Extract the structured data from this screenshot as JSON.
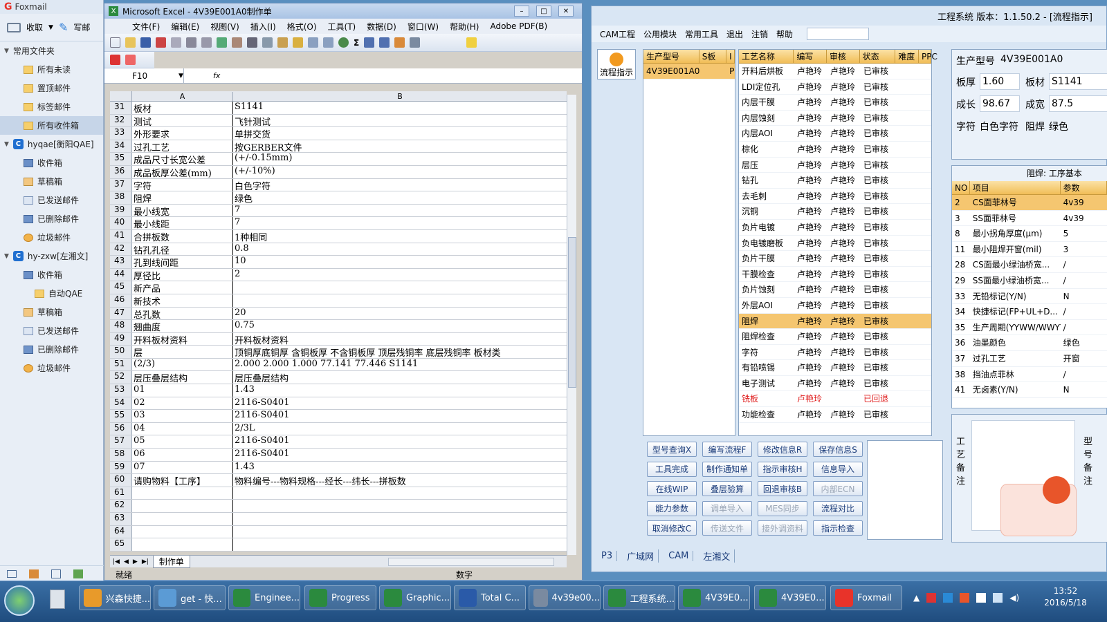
{
  "foxmail": {
    "title": "Foxmail",
    "toolbar": {
      "receive": "收取",
      "write": "写邮"
    },
    "sections": [
      {
        "label": "常用文件夹",
        "items": [
          "所有未读",
          "置顶邮件",
          "标签邮件",
          "所有收件箱"
        ]
      },
      {
        "label": "hyqae[衡阳QAE]",
        "items": [
          "收件箱",
          "草稿箱",
          "已发送邮件",
          "已删除邮件",
          "垃圾邮件"
        ]
      },
      {
        "label": "hy-zxw[左湘文]",
        "items": [
          "收件箱",
          "自动QAE",
          "草稿箱",
          "已发送邮件",
          "已删除邮件",
          "垃圾邮件"
        ]
      }
    ]
  },
  "excel": {
    "title": "Microsoft Excel - 4V39E001A0制作单",
    "menu": [
      "文件(F)",
      "编辑(E)",
      "视图(V)",
      "插入(I)",
      "格式(O)",
      "工具(T)",
      "数据(D)",
      "窗口(W)",
      "帮助(H)",
      "Adobe PDF(B)"
    ],
    "name_box": "F10",
    "fx": "fx",
    "col_a": "A",
    "col_b": "B",
    "rows": [
      [
        "31",
        "板材",
        "S1141"
      ],
      [
        "32",
        "测试",
        "飞针测试"
      ],
      [
        "33",
        "外形要求",
        "单拼交货"
      ],
      [
        "34",
        "过孔工艺",
        "按GERBER文件"
      ],
      [
        "35",
        "成品尺寸长宽公差",
        "(+/-0.15mm)"
      ],
      [
        "36",
        "成品板厚公差(mm)",
        "(+/-10%)"
      ],
      [
        "37",
        "字符",
        "白色字符"
      ],
      [
        "38",
        "阻焊",
        "绿色"
      ],
      [
        "39",
        "最小线宽",
        "7"
      ],
      [
        "40",
        "最小线距",
        "7"
      ],
      [
        "41",
        "合拼板数",
        "1种相同"
      ],
      [
        "42",
        "钻孔孔径",
        "0.8"
      ],
      [
        "43",
        "孔到线间距",
        "10"
      ],
      [
        "44",
        "厚径比",
        "2"
      ],
      [
        "45",
        "新产品",
        ""
      ],
      [
        "46",
        "新技术",
        ""
      ],
      [
        "47",
        "总孔数",
        "20"
      ],
      [
        "48",
        "翘曲度",
        "0.75"
      ],
      [
        "49",
        "开料板材资料",
        "开料板材资料"
      ],
      [
        "50",
        "层",
        "顶铜厚底铜厚 含铜板厚 不含铜板厚 顶层残铜率 底层残铜率 板材类"
      ],
      [
        "51",
        "(2/3)",
        "2.000  2.000   1.000            77.141    77.446       S1141"
      ],
      [
        "52",
        "层压叠层结构",
        "层压叠层结构"
      ],
      [
        "53",
        "01",
        "1.43"
      ],
      [
        "54",
        "02",
        "2116-S0401"
      ],
      [
        "55",
        "03",
        "2116-S0401"
      ],
      [
        "56",
        "04",
        "2/3L"
      ],
      [
        "57",
        "05",
        "2116-S0401"
      ],
      [
        "58",
        "06",
        "2116-S0401"
      ],
      [
        "59",
        "07",
        "1.43"
      ],
      [
        "60",
        "请购物料【工序】",
        "物料编号---物料规格---经长---纬长---拼板数"
      ],
      [
        "61",
        "",
        ""
      ],
      [
        "62",
        "",
        ""
      ],
      [
        "63",
        "",
        ""
      ],
      [
        "64",
        "",
        ""
      ],
      [
        "65",
        "",
        ""
      ]
    ],
    "sheet_tab": "制作单",
    "status_left": "就绪",
    "status_num": "数字"
  },
  "eng": {
    "title": "工程系统  版本：1.1.50.2 - [流程指示]",
    "menu": [
      "CAM工程",
      "公用模块",
      "常用工具",
      "退出",
      "注销",
      "帮助"
    ],
    "side_btn": "流程指示",
    "model_table": {
      "headers": [
        "生产型号",
        "S板",
        "I"
      ],
      "rows": [
        [
          "4V39E001A0",
          "",
          "P"
        ]
      ]
    },
    "process_headers": [
      "工艺名称",
      "编写",
      "审核",
      "状态",
      "难度",
      "PPC"
    ],
    "process_rows": [
      [
        "开料后烘板",
        "卢艳玲",
        "卢艳玲",
        "已审核"
      ],
      [
        "LDI定位孔",
        "卢艳玲",
        "卢艳玲",
        "已审核"
      ],
      [
        "内层干膜",
        "卢艳玲",
        "卢艳玲",
        "已审核"
      ],
      [
        "内层蚀刻",
        "卢艳玲",
        "卢艳玲",
        "已审核"
      ],
      [
        "内层AOI",
        "卢艳玲",
        "卢艳玲",
        "已审核"
      ],
      [
        "棕化",
        "卢艳玲",
        "卢艳玲",
        "已审核"
      ],
      [
        "层压",
        "卢艳玲",
        "卢艳玲",
        "已审核"
      ],
      [
        "钻孔",
        "卢艳玲",
        "卢艳玲",
        "已审核"
      ],
      [
        "去毛刺",
        "卢艳玲",
        "卢艳玲",
        "已审核"
      ],
      [
        "沉铜",
        "卢艳玲",
        "卢艳玲",
        "已审核"
      ],
      [
        "负片电镀",
        "卢艳玲",
        "卢艳玲",
        "已审核"
      ],
      [
        "负电镀磨板",
        "卢艳玲",
        "卢艳玲",
        "已审核"
      ],
      [
        "负片干膜",
        "卢艳玲",
        "卢艳玲",
        "已审核"
      ],
      [
        "干膜检查",
        "卢艳玲",
        "卢艳玲",
        "已审核"
      ],
      [
        "负片蚀刻",
        "卢艳玲",
        "卢艳玲",
        "已审核"
      ],
      [
        "外层AOI",
        "卢艳玲",
        "卢艳玲",
        "已审核"
      ],
      [
        "阻焊",
        "卢艳玲",
        "卢艳玲",
        "已审核"
      ],
      [
        "阻焊检查",
        "卢艳玲",
        "卢艳玲",
        "已审核"
      ],
      [
        "字符",
        "卢艳玲",
        "卢艳玲",
        "已审核"
      ],
      [
        "有铅喷锡",
        "卢艳玲",
        "卢艳玲",
        "已审核"
      ],
      [
        "电子测试",
        "卢艳玲",
        "卢艳玲",
        "已审核"
      ],
      [
        "铣板",
        "卢艳玲",
        "",
        "已回退"
      ],
      [
        "功能检查",
        "卢艳玲",
        "卢艳玲",
        "已审核"
      ]
    ],
    "buttons": [
      [
        "型号查询X",
        "编写流程F",
        "修改信息R",
        "保存信息S"
      ],
      [
        "工具完成",
        "制作通知单",
        "指示审核H",
        "信息导入"
      ],
      [
        "在线WIP",
        "叠层验算",
        "回退审核B",
        "内部ECN"
      ],
      [
        "能力参数",
        "调单导入",
        "MES同步",
        "流程对比"
      ],
      [
        "取消修改C",
        "传送文件",
        "接外调资料",
        "指示检查"
      ]
    ],
    "bottom_tabs": [
      "P3",
      "广域网",
      "CAM",
      "左湘文"
    ],
    "info": {
      "model_label": "生产型号",
      "model": "4V39E001A0",
      "thick_label": "板厚",
      "thick": "1.60",
      "mat_label": "板材",
      "mat": "S1141",
      "len_label": "成长",
      "len": "98.67",
      "wid_label": "成宽",
      "wid": "87.5",
      "char_label": "字符",
      "char": "白色字符",
      "solder_label": "阻焊",
      "solder": "绿色"
    },
    "process_info": {
      "title": "阻焊: 工序基本",
      "headers": [
        "NO",
        "项目",
        "参数"
      ],
      "rows": [
        [
          "2",
          "CS面菲林号",
          "4v39"
        ],
        [
          "3",
          "SS面菲林号",
          "4v39"
        ],
        [
          "8",
          "最小拐角厚度(μm)",
          "5"
        ],
        [
          "11",
          "最小阻焊开窗(mil)",
          "3"
        ],
        [
          "28",
          "CS面最小绿油桥宽...",
          "/"
        ],
        [
          "29",
          "SS面最小绿油桥宽...",
          "/"
        ],
        [
          "33",
          "无铅标记(Y/N)",
          "N"
        ],
        [
          "34",
          "快捷标记(FP+UL+D...",
          "/"
        ],
        [
          "35",
          "生产周期(YYWW/WWYY)",
          "/"
        ],
        [
          "36",
          "油墨颜色",
          "绿色"
        ],
        [
          "37",
          "过孔工艺",
          "开窗"
        ],
        [
          "38",
          "挡油点菲林",
          "/"
        ],
        [
          "41",
          "无卤素(Y/N)",
          "N"
        ]
      ]
    },
    "remarks": {
      "process": "工艺备注",
      "model": "型号备注"
    }
  },
  "taskbar": {
    "items": [
      "兴森快捷...",
      "get - 快...",
      "Enginee...",
      "Progress",
      "Graphic...",
      "Total C...",
      "4v39e00...",
      "工程系统...",
      "4V39E0...",
      "4V39E0...",
      "Foxmail"
    ],
    "time": "13:52",
    "date": "2016/5/18"
  }
}
